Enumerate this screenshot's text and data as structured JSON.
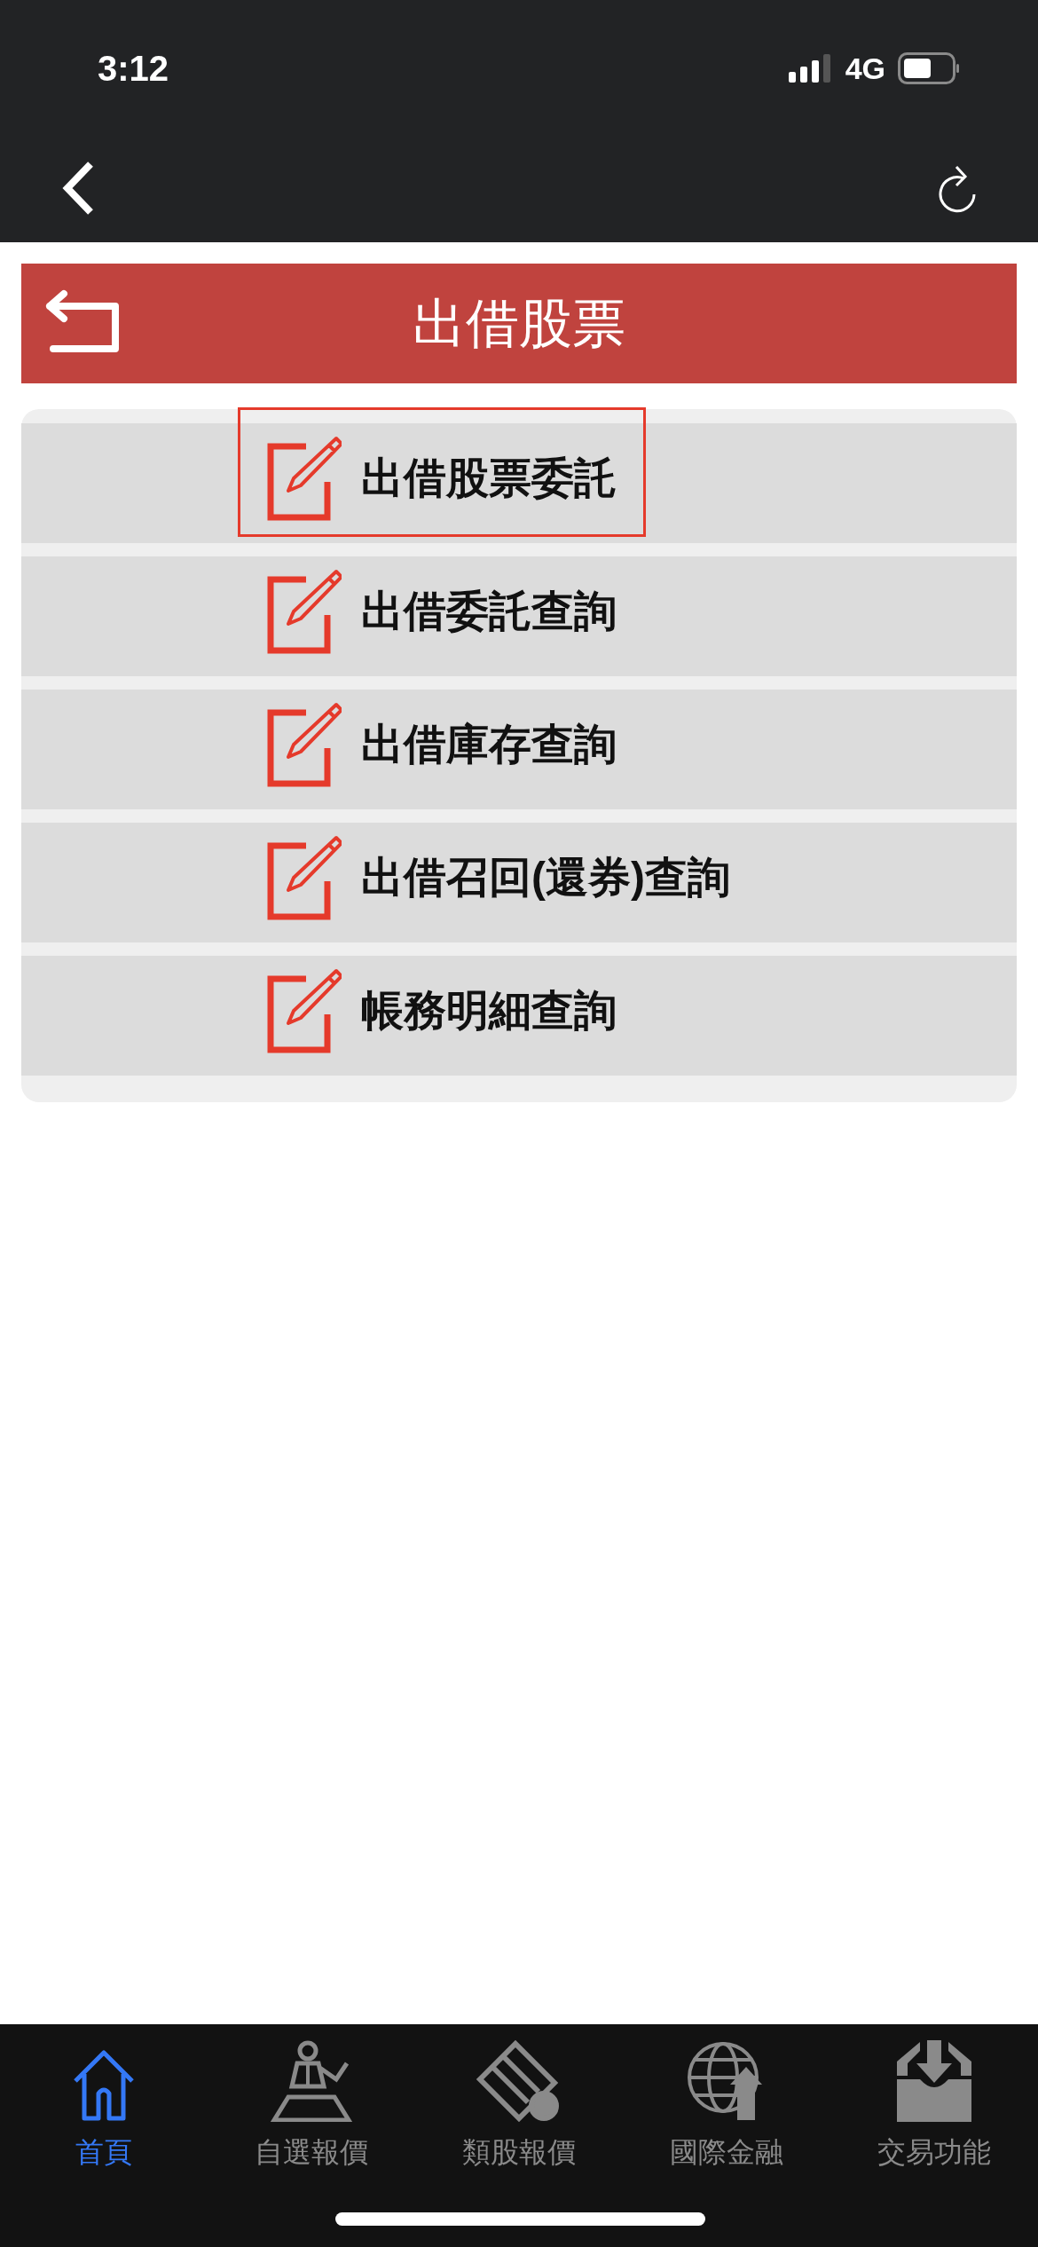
{
  "status_bar": {
    "time": "3:12",
    "network": "4G"
  },
  "header": {
    "title": "出借股票"
  },
  "menu": [
    {
      "label": "出借股票委託",
      "selected": true
    },
    {
      "label": "出借委託查詢",
      "selected": false
    },
    {
      "label": "出借庫存查詢",
      "selected": false
    },
    {
      "label": "出借召回(還券)查詢",
      "selected": false
    },
    {
      "label": "帳務明細查詢",
      "selected": false
    }
  ],
  "tab_bar": [
    {
      "kind": "home",
      "label": "首頁",
      "selected": true
    },
    {
      "kind": "person",
      "label": "自選報價",
      "selected": false
    },
    {
      "kind": "film",
      "label": "類股報價",
      "selected": false
    },
    {
      "kind": "globe",
      "label": "國際金融",
      "selected": false
    },
    {
      "kind": "inbox",
      "label": "交易功能",
      "selected": false
    }
  ]
}
